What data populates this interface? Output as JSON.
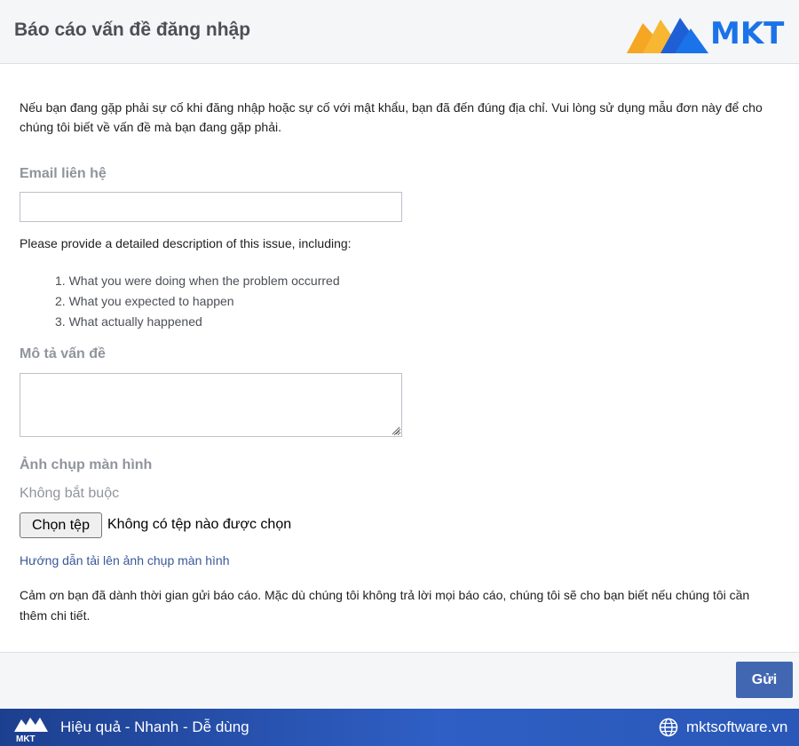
{
  "header": {
    "title": "Báo cáo vấn đề đăng nhập",
    "logo_text": "MKT",
    "logo_colors": {
      "text": "#1a73e8",
      "orange": "#f5a623",
      "blue": "#1f5fd6"
    }
  },
  "intro": "Nếu bạn đang gặp phải sự cố khi đăng nhập hoặc sự cố với mật khẩu, bạn đã đến đúng địa chỉ. Vui lòng sử dụng mẫu đơn này để cho chúng tôi biết về vấn đề mà bạn đang gặp phải.",
  "email": {
    "label": "Email liên hệ",
    "value": "",
    "placeholder": ""
  },
  "description_intro": "Please provide a detailed description of this issue, including:",
  "description_points": [
    "1. What you were doing when the problem occurred",
    "2. What you expected to happen",
    "3. What actually happened"
  ],
  "description": {
    "label": "Mô tả vấn đề",
    "value": ""
  },
  "screenshot": {
    "label": "Ảnh chụp màn hình",
    "optional": "Không bắt buộc",
    "choose_button": "Chọn tệp",
    "no_file": "Không có tệp nào được chọn",
    "help_link": "Hướng dẫn tải lên ảnh chụp màn hình"
  },
  "thanks": "Cảm ơn bạn đã dành thời gian gửi báo cáo. Mặc dù chúng tôi không trả lời mọi báo cáo, chúng tôi sẽ cho bạn biết nếu chúng tôi cần thêm chi tiết.",
  "actions": {
    "send_label": "Gửi"
  },
  "banner": {
    "logo_text": "MKT",
    "slogan": "Hiệu quả - Nhanh - Dễ dùng",
    "website": "mktsoftware.vn",
    "icon": "globe-icon"
  },
  "colors": {
    "primary_button": "#4267b2",
    "link": "#385898",
    "label_gray": "#90949c",
    "banner_start": "#1d3f8f",
    "banner_end": "#2a58b8"
  }
}
